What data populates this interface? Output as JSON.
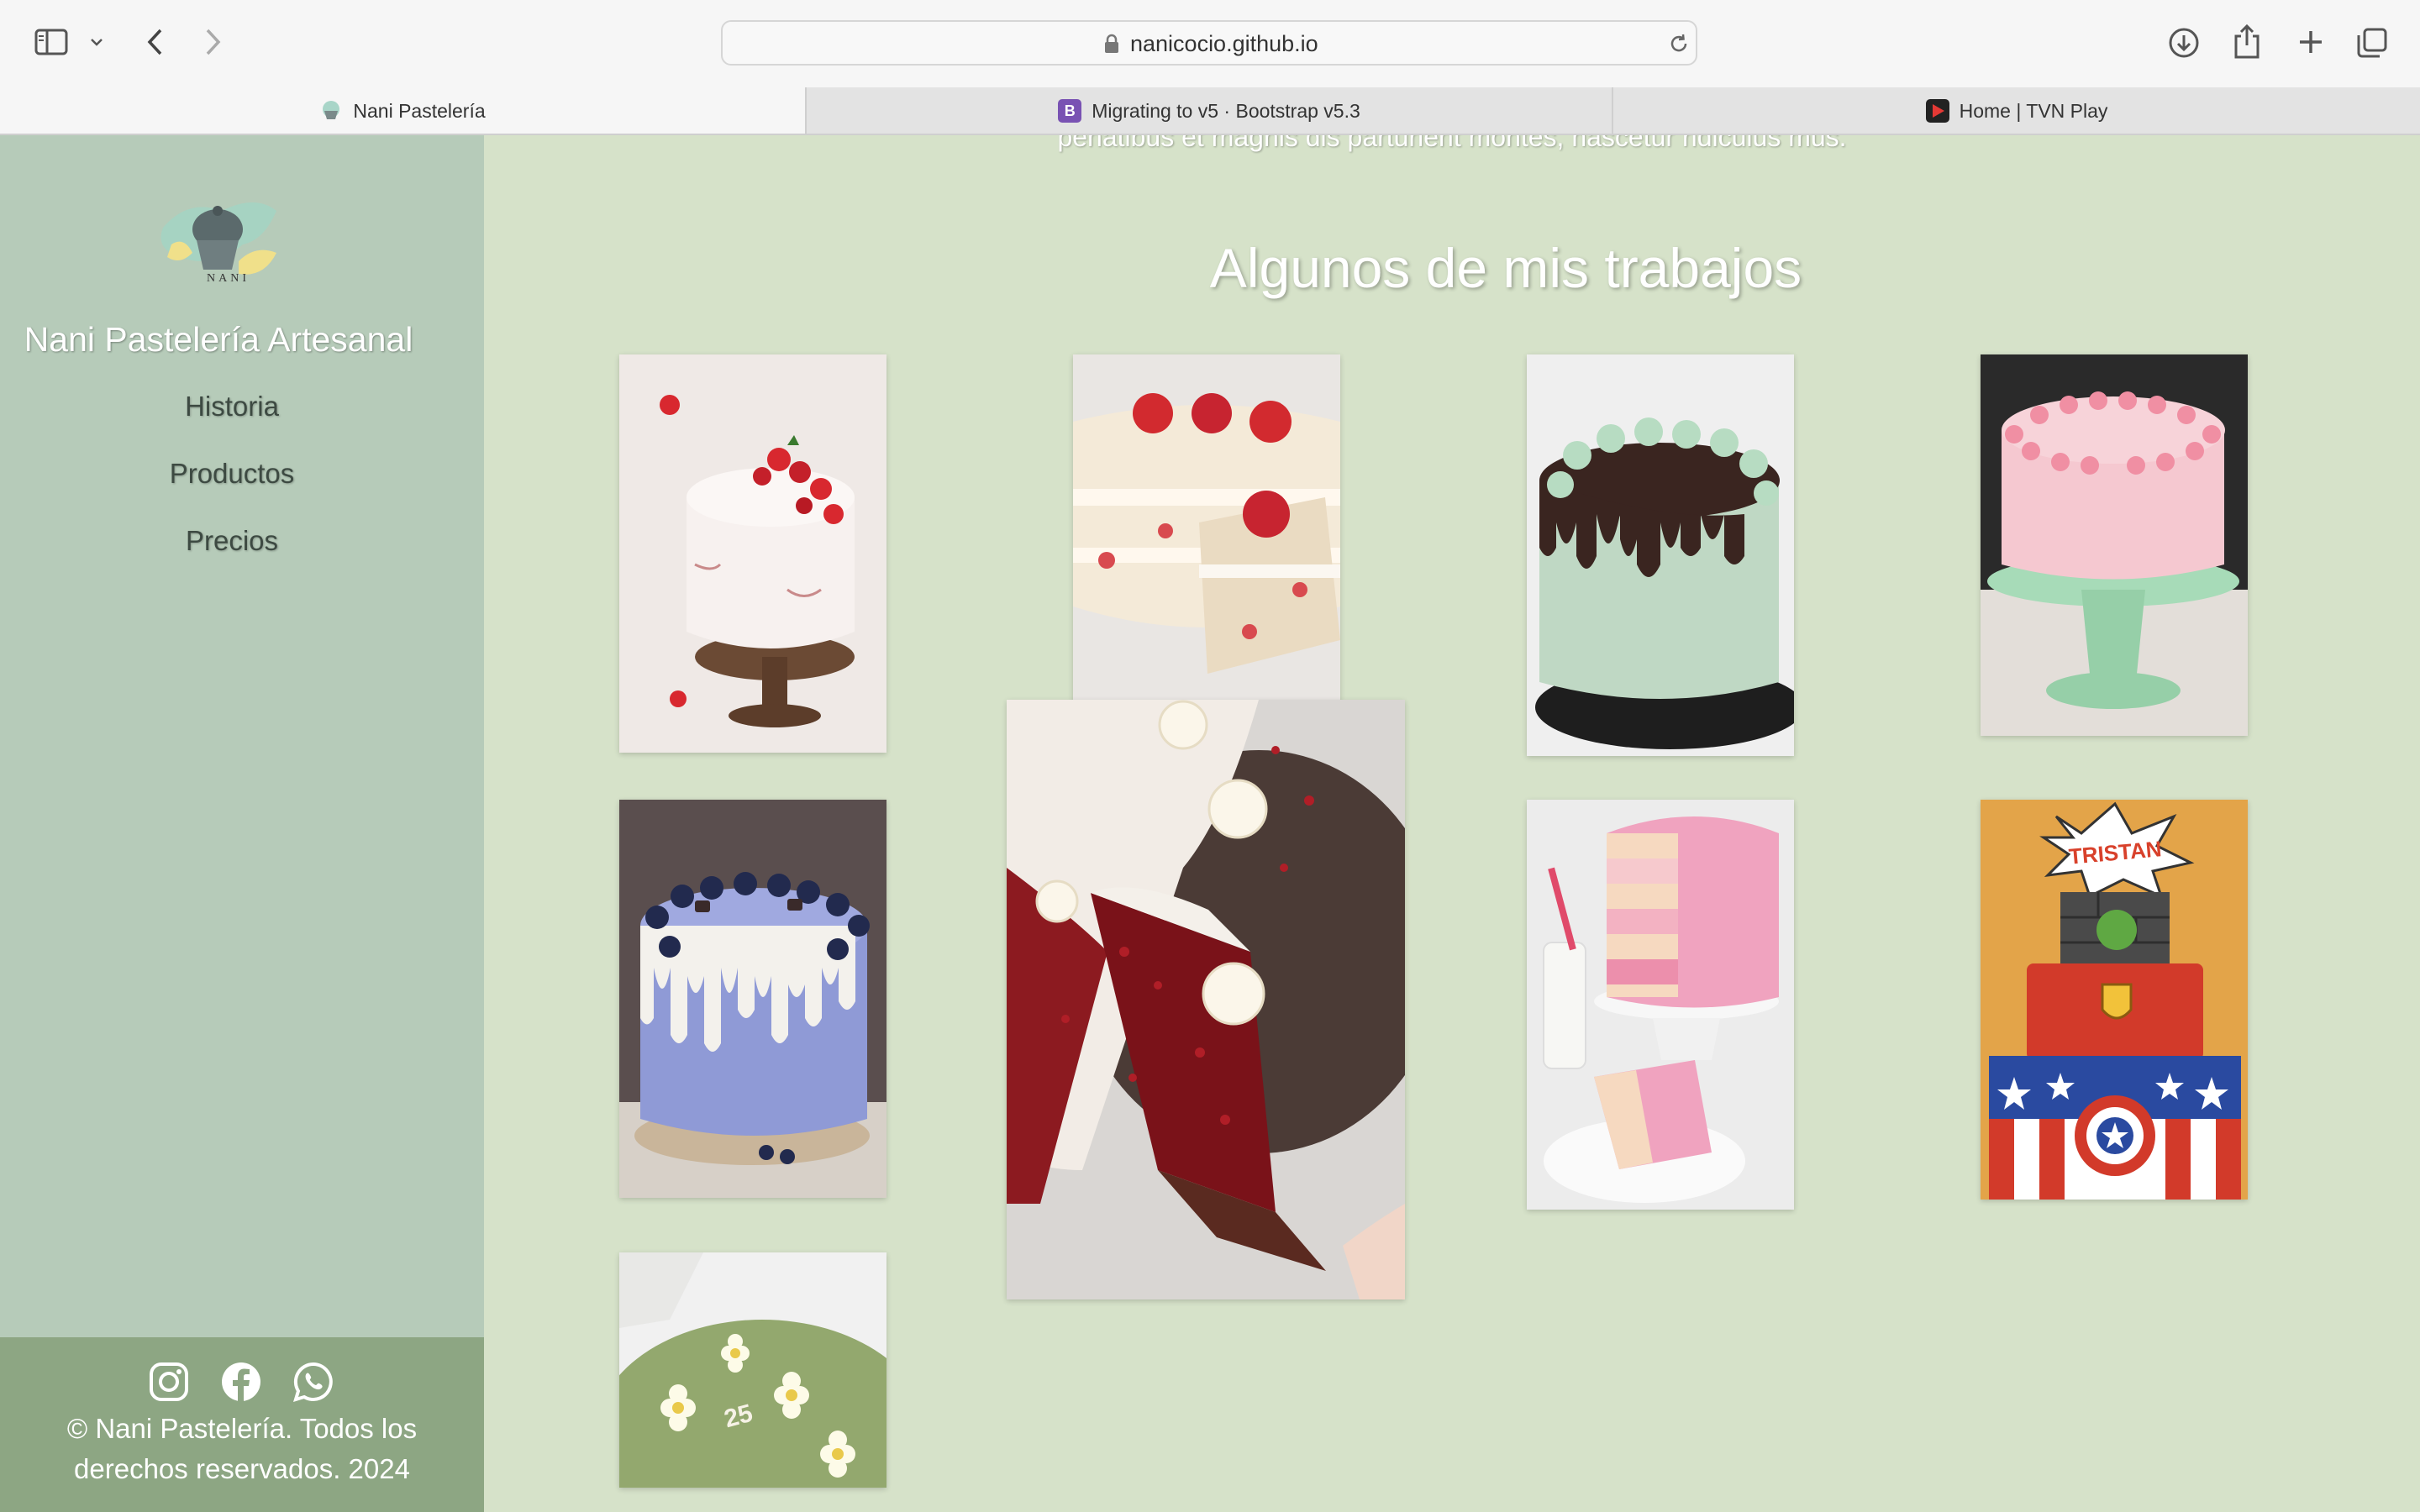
{
  "browser": {
    "url": "nanicocio.github.io",
    "tabs": [
      {
        "label": "Nani Pastelería",
        "active": true,
        "favicon": "cupcake-icon"
      },
      {
        "label": "Migrating to v5 · Bootstrap v5.3",
        "active": false,
        "favicon": "bootstrap-icon",
        "favicon_color": "#7952b3"
      },
      {
        "label": "Home | TVN Play",
        "active": false,
        "favicon": "tvn-play-icon",
        "favicon_color": "#d32f2f"
      }
    ]
  },
  "sidebar": {
    "brand": "Nani Pastelería Artesanal",
    "logo_text": "NANI",
    "nav": [
      {
        "label": "Historia"
      },
      {
        "label": "Productos"
      },
      {
        "label": "Precios"
      }
    ],
    "social": [
      "instagram-icon",
      "facebook-icon",
      "whatsapp-icon"
    ],
    "footer_line1": "© Nani Pastelería. Todos los",
    "footer_line2": "derechos reservados. 2024"
  },
  "main": {
    "cut_text": "penatibus et magnis dis parturient montes, nascetur ridiculus mus.",
    "section_title": "Algunos de mis trabajos",
    "gallery": [
      {
        "name": "strawberry-white-cake"
      },
      {
        "name": "strawberry-shortcake-slice"
      },
      {
        "name": "chocolate-drip-mint-cake"
      },
      {
        "name": "pink-funfetti-cake"
      },
      {
        "name": "blueberry-drip-cake"
      },
      {
        "name": "red-velvet-cake-enlarged"
      },
      {
        "name": "pink-ombre-rosette-cake"
      },
      {
        "name": "superhero-tiered-cake",
        "text": "TRISTAN"
      },
      {
        "name": "green-daisy-cake",
        "text": "25"
      }
    ]
  },
  "colors": {
    "page_bg": "#d6e2c9",
    "sidebar_bg": "#b6cbb9",
    "sidebar_footer_bg": "#8da683"
  }
}
